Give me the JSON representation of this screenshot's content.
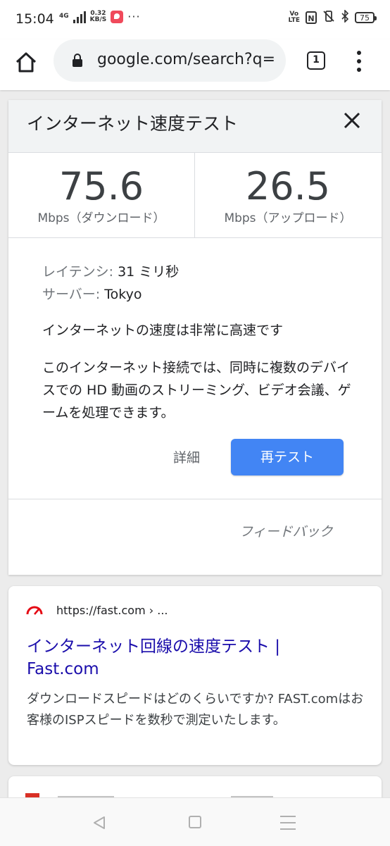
{
  "status_bar": {
    "time": "15:04",
    "network_type": "4G",
    "speed_value": "0.32",
    "speed_unit": "KB/S",
    "more": "···",
    "volte_1": "Vo",
    "volte_2": "LTE",
    "nfc": "N",
    "battery": "75"
  },
  "browser": {
    "url": "google.com/search?q=",
    "tab_count": "1"
  },
  "speed_test": {
    "title": "インターネット速度テスト",
    "download_value": "75.6",
    "download_label": "Mbps（ダウンロード）",
    "upload_value": "26.5",
    "upload_label": "Mbps（アップロード）",
    "latency_label": "レイテンシ:",
    "latency_value": " 31 ミリ秒",
    "server_label": "サーバー:",
    "server_value": " Tokyo",
    "summary": "インターネットの速度は非常に高速です",
    "description": "このインターネット接続では、同時に複数のデバイスでの HD 動画のストリーミング、ビデオ会議、ゲームを処理できます。",
    "details_label": "詳細",
    "retest_label": "再テスト",
    "feedback_label": "フィードバック",
    "accent_color": "#4285f4"
  },
  "result": {
    "url": "https://fast.com › ...",
    "title": "インターネット回線の速度テスト | Fast.com",
    "snippet": "ダウンロードスピードはどのくらいですか? FAST.comはお客様のISPスピードを数秒で測定いたします。",
    "favicon": "fast-speedometer-icon",
    "link_color": "#1a0dab"
  },
  "icons": {
    "home": "home-icon",
    "lock": "lock-icon",
    "close": "close-icon",
    "menu": "more-vert-icon",
    "back": "back-icon",
    "nav_home": "home-square-icon",
    "recent": "recent-apps-icon"
  }
}
